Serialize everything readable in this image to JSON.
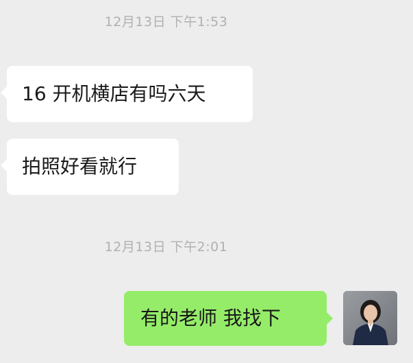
{
  "messages": [
    {
      "type": "timestamp",
      "text": "12月13日 下午1:53"
    },
    {
      "type": "incoming",
      "text": "16 开机横店有吗六天"
    },
    {
      "type": "incoming",
      "text": "拍照好看就行"
    },
    {
      "type": "timestamp",
      "text": "12月13日 下午2:01"
    },
    {
      "type": "outgoing",
      "text": "有的老师 我找下"
    }
  ],
  "colors": {
    "background": "#ededed",
    "incoming_bubble": "#ffffff",
    "outgoing_bubble": "#95ec69",
    "timestamp_text": "#b0b0b0",
    "message_text": "#191919"
  },
  "icons": {
    "avatar": "user-avatar-photo"
  }
}
